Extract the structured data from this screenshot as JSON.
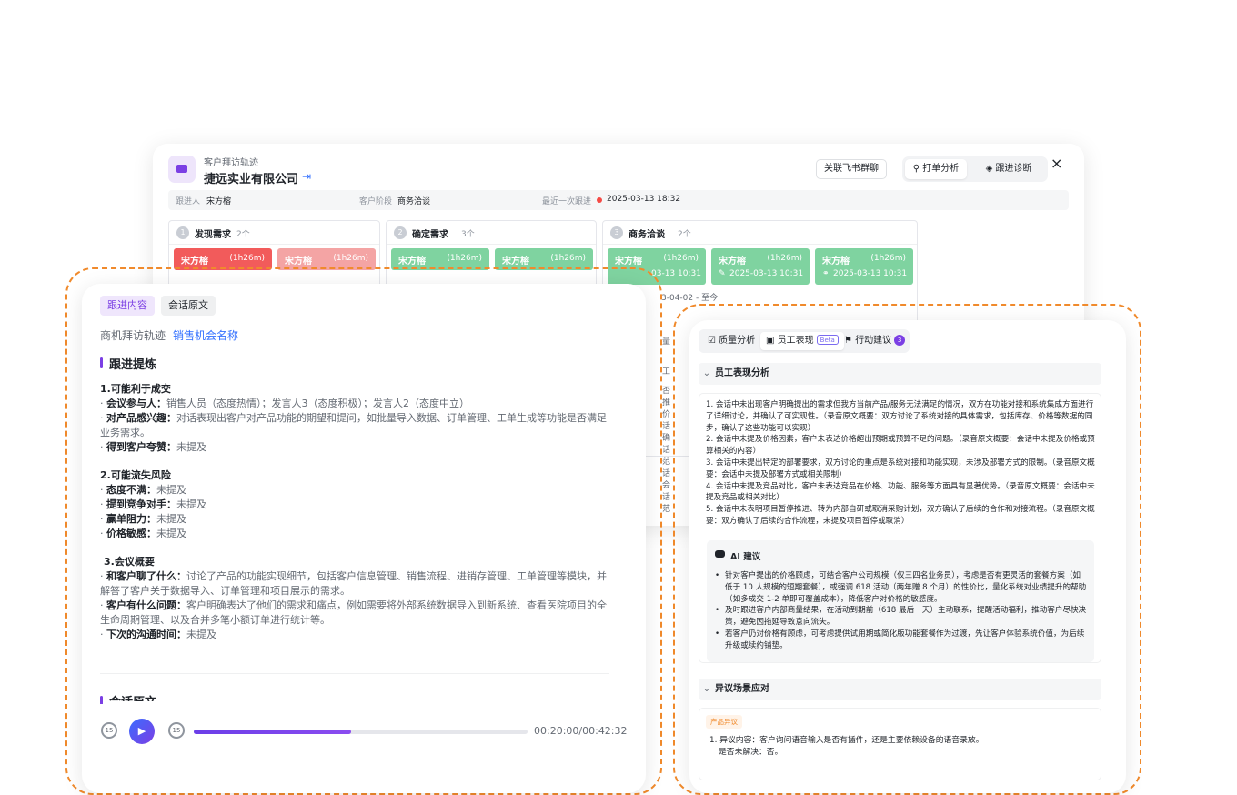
{
  "back": {
    "subtitle": "客户拜访轨迹",
    "company": "捷远实业有限公司",
    "link_feishu": "关联飞书群聊",
    "seg_active": "打单分析",
    "seg_inactive": "跟进诊断",
    "close_icon": "×",
    "info": {
      "owner_label": "跟进人",
      "owner": "宋方榕",
      "stage_label": "客户阶段",
      "stage": "商务洽谈",
      "last_label": "最近一次跟进",
      "last": "2025-03-13 18:32"
    },
    "stages": [
      {
        "num": "1",
        "title": "发现需求",
        "count": "2个"
      },
      {
        "num": "2",
        "title": "确定需求",
        "count": "3个"
      },
      {
        "num": "3",
        "title": "商务洽谈",
        "count": "2个"
      }
    ],
    "cards": [
      {
        "name": "宋方榕",
        "dur": "(1h26m)",
        "color": "red"
      },
      {
        "name": "宋方榕",
        "dur": "(1h26m)",
        "color": "pink"
      },
      {
        "name": "宋方榕",
        "dur": "(1h26m)",
        "color": "green"
      },
      {
        "name": "宋方榕",
        "dur": "(1h26m)",
        "color": "green"
      },
      {
        "name": "宋方榕",
        "dur": "(1h26m)",
        "time": "03-13 10:31"
      },
      {
        "name": "宋方榕",
        "dur": "(1h26m)",
        "time": "2025-03-13 10:31"
      },
      {
        "name": "宋方榕",
        "dur": "(1h26m)",
        "time": "2025-03-13 10:31"
      }
    ],
    "period": "3-04-02 - 至今"
  },
  "left": {
    "tab_active": "跟进内容",
    "tab_inactive": "会话原文",
    "crumb": "商机拜访轨迹",
    "crumb_link": "销售机会名称",
    "heading": "跟进提炼",
    "sections": {
      "s1": "1.可能利于成交",
      "s1_items": [
        {
          "k": "会议参与人：",
          "v": "销售人员（态度热情）；发言人3（态度积极）；发言人2（态度中立）"
        },
        {
          "k": "对产品感兴趣：",
          "v": "对话表现出客户对产品功能的期望和提问，如批量导入数据、订单管理、工单生成等功能是否满足业务需求。"
        },
        {
          "k": "得到客户夸赞：",
          "v": "未提及"
        }
      ],
      "s2": "2.可能流失风险",
      "s2_items": [
        {
          "k": "态度不满：",
          "v": "未提及"
        },
        {
          "k": "提到竞争对手：",
          "v": "未提及"
        },
        {
          "k": "赢单阻力：",
          "v": "未提及"
        },
        {
          "k": "价格敏感：",
          "v": "未提及"
        }
      ],
      "s3": "3.会议概要",
      "s3_items": [
        {
          "k": "和客户聊了什么：",
          "v": "讨论了产品的功能实现细节，包括客户信息管理、销售流程、进销存管理、工单管理等模块，并解答了客户关于数据导入、订单管理和项目展示的需求。"
        },
        {
          "k": "客户有什么问题：",
          "v": "客户明确表达了他们的需求和痛点，例如需要将外部系统数据导入到新系统、查看医院项目的全生命周期管理、以及合并多笔小额订单进行统计等。"
        },
        {
          "k": "下次的沟通时间：",
          "v": "未提及"
        }
      ]
    },
    "heading2": "会话原文",
    "player": {
      "rewind": "15",
      "forward": "15",
      "progress": 0.472,
      "time": "00:20:00/00:42:32"
    }
  },
  "right": {
    "tabs": [
      "质量分析",
      "员工表现",
      "行动建议"
    ],
    "beta": "Beta",
    "badge": "3",
    "sec1": "员工表现分析",
    "perf": [
      "1. 会话中未出现客户明确提出的需求但我方当前产品/服务无法满足的情况，双方在功能对接和系统集成方面进行了详细讨论，并确认了可实现性。（录音原文概要：双方讨论了系统对接的具体需求，包括库存、价格等数据的同步，确认了这些功能可以实现）",
      "2. 会话中未提及价格因素，客户未表达价格超出预期或预算不足的问题。（录音原文概要：会话中未提及价格或预算相关的内容）",
      "3. 会话中未提出特定的部署要求，双方讨论的重点是系统对接和功能实现，未涉及部署方式的限制。（录音原文概要：会话中未提及部署方式或相关限制）",
      "4. 会话中未提及竞品对比，客户未表达竞品在价格、功能、服务等方面具有显著优势。（录音原文概要：会话中未提及竞品或相关对比）",
      "5. 会话中未表明项目暂停推进、转为内部自研或取消采购计划，双方确认了后续的合作和对接流程。（录音原文概要：双方确认了后续的合作流程，未提及项目暂停或取消）"
    ],
    "ai_title": "AI 建议",
    "ai_items": [
      "针对客户提出的价格顾虑，可结合客户公司规模（仅三四名业务员），考虑是否有更灵活的套餐方案（如低于 10 人规模的短期套餐），或强调 618 活动（两年赠 8 个月）的性价比，量化系统对业绩提升的帮助（如多成交 1-2 单即可覆盖成本），降低客户对价格的敏感度。",
      "及时跟进客户内部商量结果，在活动到期前（618 最后一天）主动联系，提醒活动福利，推动客户尽快决策，避免因拖延导致意向流失。",
      "若客户仍对价格有顾虑，可考虑提供试用期或简化版功能套餐作为过渡，先让客户体验系统价值，为后续升级或续约铺垫。"
    ],
    "sec2": "异议场景应对",
    "tag": "产品异议",
    "obj_lines": [
      "1. 异议内容：客户询问语音输入是否有插件，还是主要依赖设备的语音录放。",
      "是否未解决：否。"
    ]
  },
  "sliver": [
    "量",
    "工",
    "否",
    "推",
    "价",
    "话",
    "确",
    "话",
    "范",
    "话",
    "会",
    "话",
    "范"
  ]
}
